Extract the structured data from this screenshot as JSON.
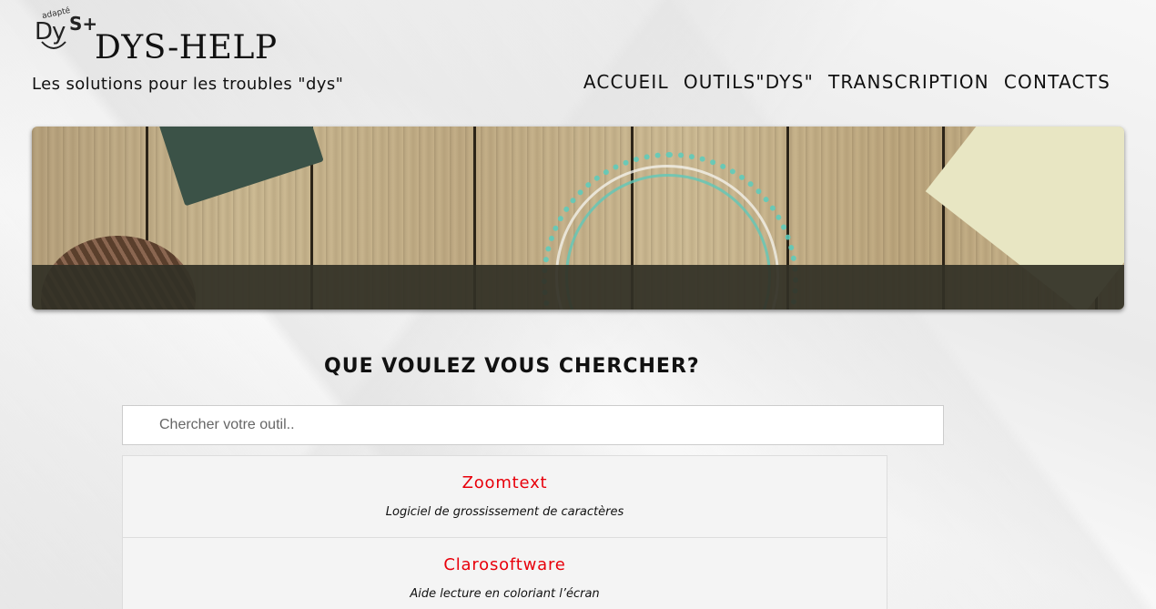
{
  "header": {
    "logo": {
      "adapte_text": "adapté",
      "dys_text": "Dy",
      "plus_text": "S+"
    },
    "site_title": "DYS-HELP",
    "tagline": "Les solutions pour les troubles \"dys\""
  },
  "nav": {
    "items": [
      {
        "label": "ACCUEIL"
      },
      {
        "label": "OUTILS\"DYS\""
      },
      {
        "label": "TRANSCRIPTION"
      },
      {
        "label": "CONTACTS"
      }
    ]
  },
  "search": {
    "heading": "QUE VOULEZ VOUS CHERCHER?",
    "placeholder": "Chercher votre outil..",
    "value": ""
  },
  "results": [
    {
      "name": "Zoomtext",
      "description": "Logiciel de grossissement de caractères"
    },
    {
      "name": "Clarosoftware",
      "description": "Aide lecture en coloriant l’écran"
    }
  ],
  "colors": {
    "link_red": "#e8000b",
    "band_dark": "#32302a",
    "teal_accent": "#5acdbe"
  }
}
